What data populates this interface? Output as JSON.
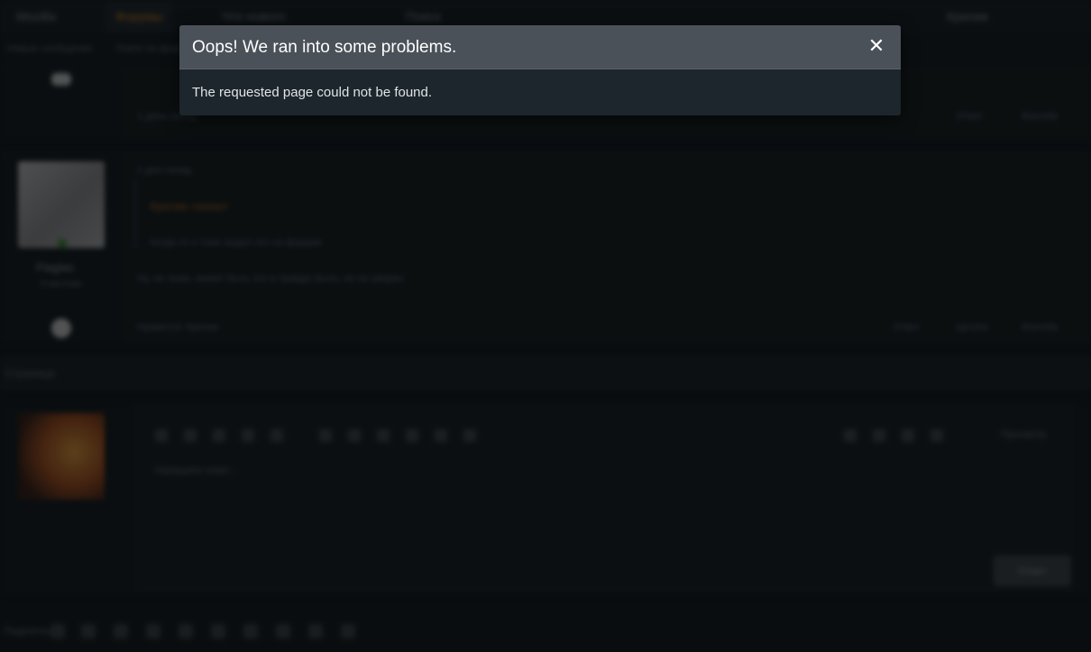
{
  "background": {
    "nav": {
      "items": [
        {
          "icon": "home-icon",
          "label": "Mozilla"
        },
        {
          "icon": "forum-icon",
          "label": "Форумы"
        },
        {
          "icon": "news-icon",
          "label": "Что нового"
        },
        {
          "icon": "search-icon",
          "label": "Поиск"
        }
      ],
      "user_label": "Крилик"
    },
    "subnav": [
      "Новые сообщения",
      "Поиск по форуму"
    ],
    "post1": {
      "date": "1 день назад",
      "actions": [
        "Ответ",
        "Жалоба"
      ]
    },
    "post2": {
      "username": "Flaglas",
      "user_title": "Участник",
      "date": "2 дня назад",
      "quote_author": "Крилик сказал",
      "quote_text": "Когда-то я тоже видел это на форуме",
      "body": "Ну, не знаю, может быть это и правда было, но не уверен",
      "reactions": "Нравится: Крилик",
      "actions": [
        "Ответ",
        "Цитата",
        "Жалоба"
      ]
    },
    "pagination_label": "Страница",
    "editor_placeholder": "Напишите ответ...",
    "preview_label": "Просмотр",
    "post_button": "Ответ",
    "share_label": "Поделиться:"
  },
  "modal": {
    "title": "Oops! We ran into some problems.",
    "close_icon": "close-icon",
    "message": "The requested page could not be found."
  },
  "colors": {
    "page_bg": "#0f1417",
    "modal_header": "#4a5158",
    "modal_body": "#1d262c",
    "accent": "#e08a1e"
  }
}
